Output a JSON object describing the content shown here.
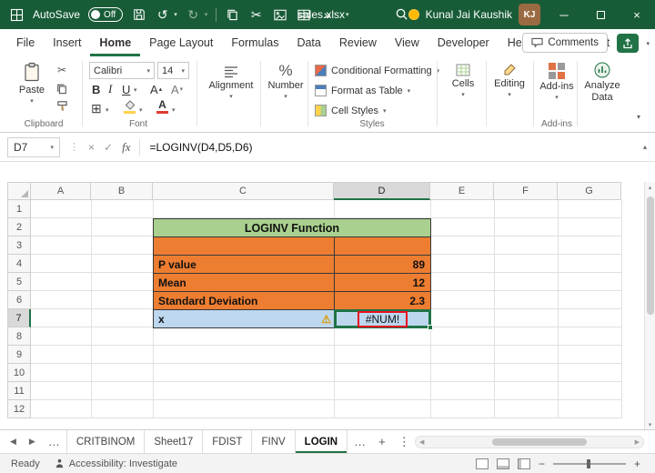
{
  "titlebar": {
    "autosave": "AutoSave",
    "autosave_state": "Off",
    "filename": "sales.xlsx",
    "user": "Kunal Jai Kaushik",
    "user_initials": "KJ"
  },
  "menubar": {
    "tabs": [
      "File",
      "Insert",
      "Home",
      "Page Layout",
      "Formulas",
      "Data",
      "Review",
      "View",
      "Developer",
      "Help",
      "Power Pivot"
    ],
    "active_tab": "Home",
    "comments": "Comments"
  },
  "ribbon": {
    "paste": "Paste",
    "clipboard_group": "Clipboard",
    "font_name": "Calibri",
    "font_size": "14",
    "font_group": "Font",
    "alignment": "Alignment",
    "number": "Number",
    "conditional_formatting": "Conditional Formatting",
    "format_as_table": "Format as Table",
    "cell_styles": "Cell Styles",
    "styles_group": "Styles",
    "cells": "Cells",
    "editing": "Editing",
    "addins": "Add-ins",
    "addins_group": "Add-ins",
    "analyze_data": "Analyze Data"
  },
  "formula_bar": {
    "name_box": "D7",
    "fx": "fx",
    "formula": "=LOGINV(D4,D5,D6)"
  },
  "grid": {
    "col_headers": [
      "A",
      "B",
      "C",
      "D",
      "E",
      "F",
      "G"
    ],
    "row_headers": [
      "1",
      "2",
      "3",
      "4",
      "5",
      "6",
      "7",
      "8",
      "9",
      "10",
      "11",
      "12"
    ],
    "selected_col": "D",
    "selected_row": "7",
    "selected_cell": "D7",
    "table": {
      "title": "LOGINV Function",
      "rows": [
        {
          "label": "P value",
          "value": "89"
        },
        {
          "label": "Mean",
          "value": "12"
        },
        {
          "label": "Standard Deviation",
          "value": "2.3"
        },
        {
          "label": "x",
          "value": "#NUM!"
        }
      ]
    }
  },
  "sheet_bar": {
    "tabs": [
      "CRITBINOM",
      "Sheet17",
      "FDIST",
      "FINV",
      "LOGIN"
    ],
    "active_tab": "LOGIN"
  },
  "status_bar": {
    "mode": "Ready",
    "accessibility": "Accessibility: Investigate"
  },
  "colors": {
    "titlebar_green": "#185c37",
    "accent_green": "#217346",
    "table_header_green": "#a9d08e",
    "table_orange": "#ed7d31",
    "table_blue": "#bdd7ee",
    "error_red": "#e81123"
  }
}
